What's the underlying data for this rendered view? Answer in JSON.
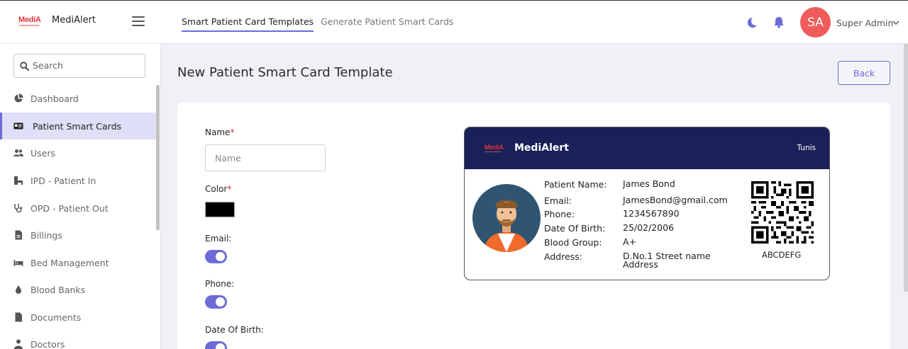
{
  "app": {
    "logo_text": "MediA",
    "name": "MediAlert"
  },
  "header": {
    "tabs": [
      {
        "label": "Smart Patient Card Templates",
        "active": true
      },
      {
        "label": "Generate Patient Smart Cards",
        "active": false
      }
    ],
    "user": {
      "initials": "SA",
      "name": "Super Admin"
    },
    "icons": [
      "hamburger-icon",
      "moon-icon",
      "bell-icon",
      "chevron-down-icon"
    ],
    "colors": {
      "accent": "#6d6bd8",
      "avatar": "#f05c5c"
    }
  },
  "sidebar": {
    "search_placeholder": "Search",
    "items": [
      {
        "label": "Dashboard",
        "icon": "pie-chart-icon",
        "active": false
      },
      {
        "label": "Patient Smart Cards",
        "icon": "id-card-icon",
        "active": true
      },
      {
        "label": "Users",
        "icon": "users-icon",
        "active": false
      },
      {
        "label": "IPD - Patient In",
        "icon": "hospital-bed-icon",
        "active": false
      },
      {
        "label": "OPD - Patient Out",
        "icon": "stethoscope-icon",
        "active": false
      },
      {
        "label": "Billings",
        "icon": "invoice-icon",
        "active": false
      },
      {
        "label": "Bed Management",
        "icon": "bed-icon",
        "active": false
      },
      {
        "label": "Blood Banks",
        "icon": "blood-drop-icon",
        "active": false
      },
      {
        "label": "Documents",
        "icon": "document-icon",
        "active": false
      },
      {
        "label": "Doctors",
        "icon": "doctor-icon",
        "active": false
      }
    ]
  },
  "main": {
    "title": "New Patient Smart Card Template",
    "back_label": "Back",
    "form": {
      "name_label": "Name",
      "name_placeholder": "Name",
      "required_mark": "*",
      "color_label": "Color",
      "color_value": "#000000",
      "email_label": "Email:",
      "email_enabled": true,
      "phone_label": "Phone:",
      "phone_enabled": true,
      "dob_label": "Date Of Birth:",
      "dob_enabled": true
    },
    "card_preview": {
      "brand": "MediAlert",
      "logo_text": "MediA",
      "city": "Tunis",
      "header_color": "#1a2058",
      "fields": [
        {
          "label": "Patient Name:",
          "value": "James Bond"
        },
        {
          "label": "Email:",
          "value": "JamesBond@gmail.com"
        },
        {
          "label": "Phone:",
          "value": "1234567890"
        },
        {
          "label": "Date Of Birth:",
          "value": "25/02/2006"
        },
        {
          "label": "Blood Group:",
          "value": "A+"
        },
        {
          "label": "Address:",
          "value": "D.No.1 Street name Address"
        }
      ],
      "patient_code": "ABCDEFG"
    }
  }
}
